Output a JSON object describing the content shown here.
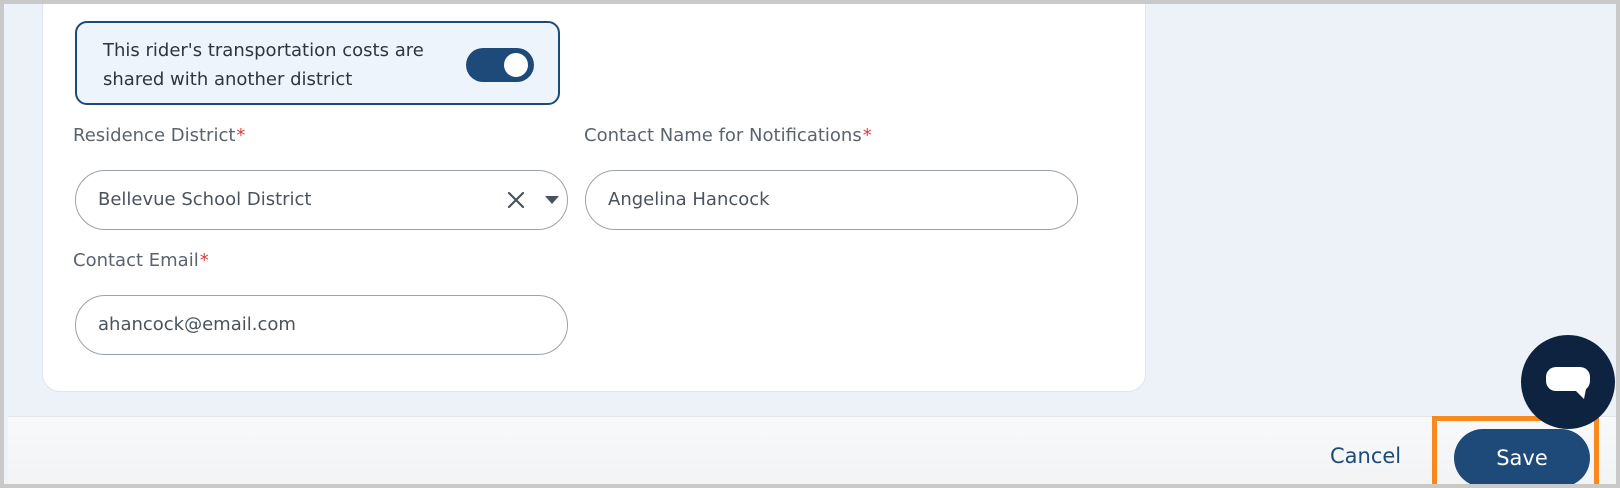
{
  "shared_costs": {
    "label": "This rider's transportation costs are shared with another district",
    "enabled": true
  },
  "residence_district": {
    "label": "Residence District",
    "required_mark": "*",
    "value": "Bellevue School District"
  },
  "contact_name": {
    "label": "Contact Name for Notifications",
    "required_mark": "*",
    "value": "Angelina Hancock"
  },
  "contact_email": {
    "label": "Contact Email",
    "required_mark": "*",
    "value": "ahancock@email.com"
  },
  "footer": {
    "cancel_label": "Cancel",
    "save_label": "Save"
  },
  "colors": {
    "accent": "#1e4a7a",
    "required": "#e03a3a",
    "highlight": "#f7891e",
    "chat_button": "#0e2340"
  },
  "icons": {
    "clear": "close-icon",
    "dropdown": "chevron-down-icon",
    "chat": "chat-icon"
  }
}
